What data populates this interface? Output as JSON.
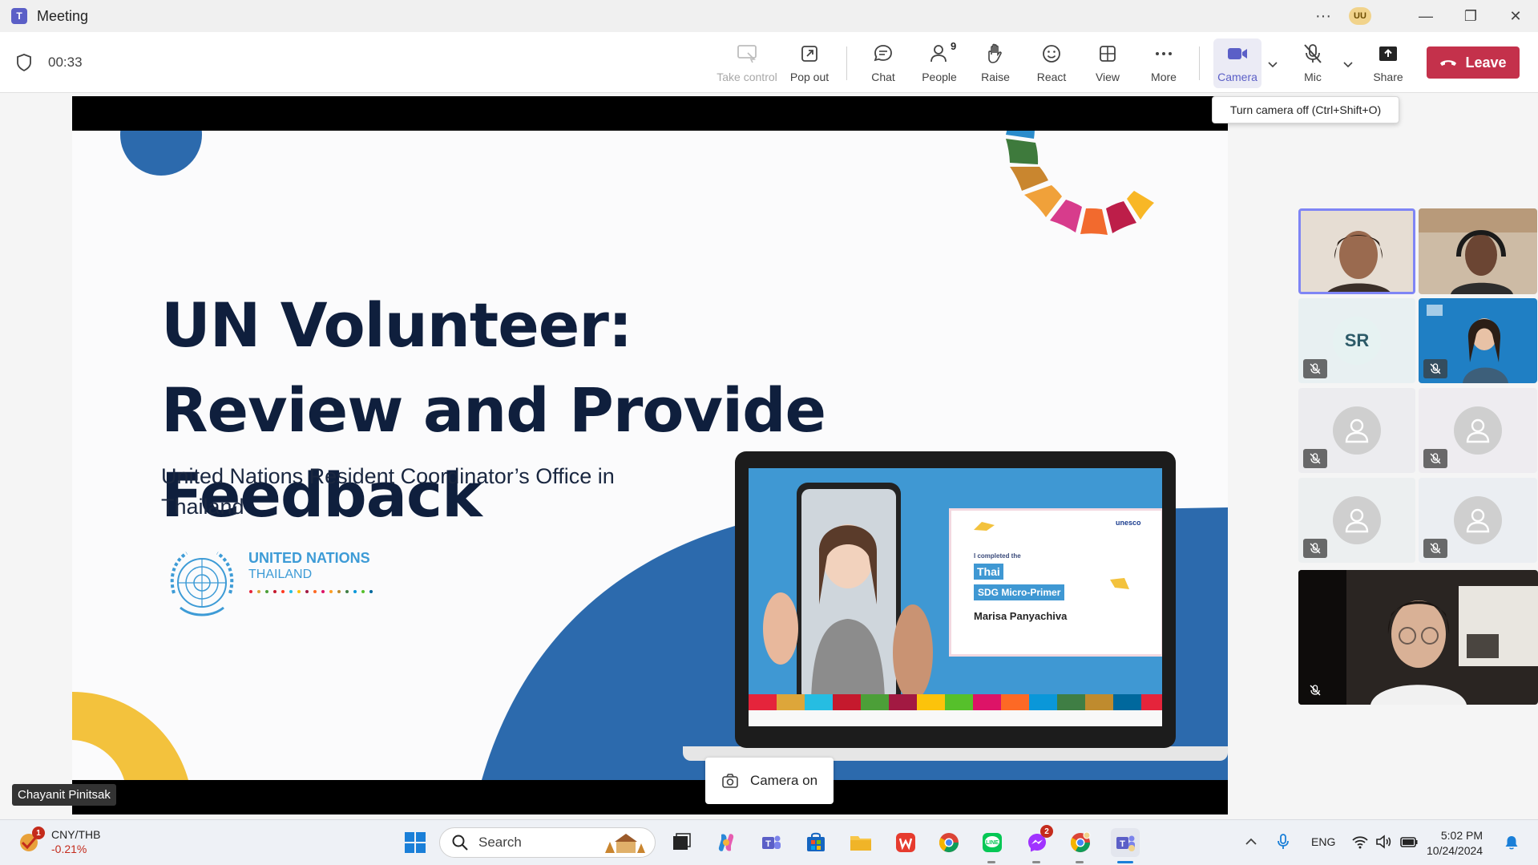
{
  "window": {
    "title": "Meeting",
    "user_initials": "UU"
  },
  "meeting": {
    "timer": "00:33"
  },
  "toolbar": {
    "take_control": "Take control",
    "pop_out": "Pop out",
    "chat": "Chat",
    "people": "People",
    "people_count": "9",
    "raise": "Raise",
    "react": "React",
    "view": "View",
    "more": "More",
    "camera": "Camera",
    "mic": "Mic",
    "share": "Share",
    "leave": "Leave"
  },
  "tooltip": {
    "text": "Turn camera off (Ctrl+Shift+O)"
  },
  "slide": {
    "title": "UN Volunteer: Review and Provide Feedback",
    "subtitle": "United Nations Resident Coordinator’s Office in Thailand",
    "logo_line1": "UNITED NATIONS",
    "logo_line2": "THAILAND",
    "certificate": {
      "line1": "I completed the",
      "line2": "Thai",
      "line3": "SDG Micro-Primer",
      "name": "Marisa Panyachiva",
      "unesco": "unesco"
    }
  },
  "gallery": {
    "initials": "SR"
  },
  "presenter_name": "Chayanit Pinitsak",
  "camera_on_label": "Camera on",
  "taskbar": {
    "stock_pair": "CNY/THB",
    "stock_change": "-0.21%",
    "stock_badge": "1",
    "search_placeholder": "Search",
    "messenger_badge": "2",
    "language": "ENG",
    "time": "5:02 PM",
    "date": "10/24/2024"
  },
  "colors": {
    "accent": "#5b5fc7",
    "leave": "#c4314b",
    "slide_title": "#0f1f3d",
    "un_blue": "#3d9bd6"
  }
}
